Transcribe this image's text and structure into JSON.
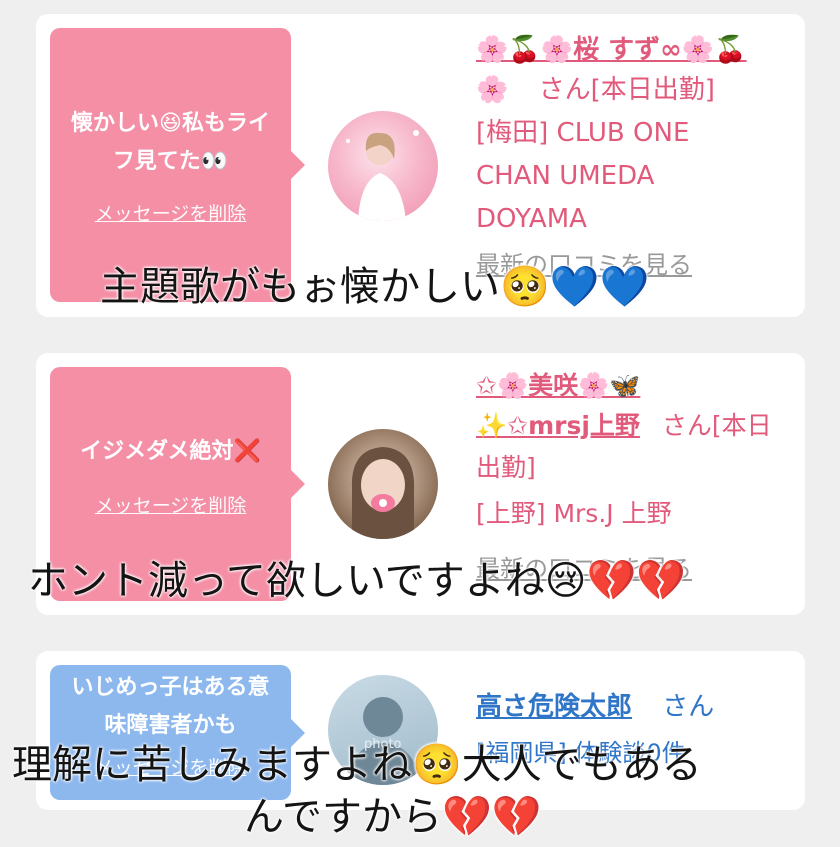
{
  "cards": [
    {
      "message": "懐かしい😆私もライフ見てた👀",
      "delete_label": "メッセージを削除",
      "name_line1": "🌸🍒🌸桜 すず∞🌸🍒",
      "name_line2": "🌸",
      "suffix": "さん[本日出勤]",
      "shop": "[梅田] CLUB ONE CHAN UMEDA DOYAMA",
      "latest": "最新の口コミを見る"
    },
    {
      "message": "イジメダメ絶対❌",
      "delete_label": "メッセージを削除",
      "name_line1": "✩🌸美咲🌸🦋",
      "name_line2": "✨✩mrsj上野",
      "suffix": "さん[本日出勤]",
      "shop": "[上野] Mrs.J 上野",
      "latest": "最新の口コミを見る"
    },
    {
      "message": "いじめっ子はある意味障害者かも",
      "delete_label": "メッセージを削除",
      "name_line1": "高さ危険太郎",
      "suffix": "さん",
      "shop": "[福岡県] 体験談0件",
      "avatar_text": "photo"
    }
  ],
  "captions": [
    "主題歌がもぉ懐かしい🥺💙💙",
    "ホント減って欲しいですよね😢💔💔",
    "理解に苦しみますよね🥺大人でもある",
    "んですから💔💔"
  ]
}
